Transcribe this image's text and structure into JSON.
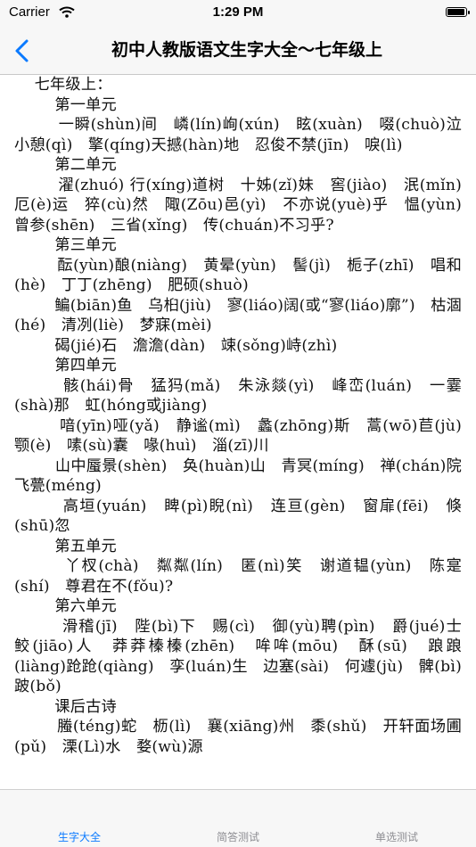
{
  "status_bar": {
    "carrier": "Carrier",
    "time": "1:29 PM"
  },
  "nav": {
    "title": "初中人教版语文生字大全～七年级上"
  },
  "content": {
    "text": "    七年级上：\n        第一单元\n        一瞬(shùn)间　嶙(lín)峋(xún)　眩(xuàn)　啜(chuò)泣　小憩(qì)　擎(qíng)天撼(hàn)地　忍俊不禁(jīn)　唳(lì)\n        第二单元\n        濯(zhuó) 行(xíng)道树　十姊(zǐ)妹　窖(jiào)　泯(mǐn)　厄(è)运　猝(cù)然　陬(Zōu)邑(yì)　不亦说(yuè)乎　愠(yùn)　曾参(shēn)　三省(xǐng)　传(chuán)不习乎?\n        第三单元\n        酝(yùn)酿(niàng)　黄晕(yùn)　髻(jì)　栀子(zhī)　唱和(hè)　丁丁(zhēng)　肥硕(shuò)\n        鳊(biān)鱼　乌桕(jiù)　寥(liáo)阔(或“寥(liáo)廓”)　枯涸(hé)　清冽(liè)　梦寐(mèi)\n        碣(jié)石　澹澹(dàn)　竦(sǒng)峙(zhì)\n        第四单元\n        骸(hái)骨　猛犸(mǎ)　朱泳燚(yì)　峰峦(luán)　一霎(shà)那　虹(hóng或jiàng)\n        喑(yīn)哑(yǎ)　静谧(mì)　蠡(zhōng)斯　蒿(wō)苣(jù)　颚(è)　嗉(sù)囊　喙(huì)　淄(zī)川\n        山中蜃景(shèn)　奂(huàn)山　青冥(míng)　禅(chán)院　飞甍(méng)\n        高垣(yuán)　睥(pì)睨(nì)　连亘(gèn)　窗扉(fēi)　倏(shū)忽\n        第五单元\n        丫杈(chà)　粼粼(lín)　匿(nì)笑　谢道韫(yùn)　陈寔(shí)　尊君在不(fǒu)?\n        第六单元\n        滑稽(jī)　陛(bì)下　赐(cì)　御(yù)聘(pìn)　爵(jué)士　鲛(jiāo)人　莽莽榛榛(zhēn)　哞哞(mōu)　酥(sū)　踉踉(liàng)跄跄(qiàng)　孪(luán)生　边塞(sài)　何遽(jù)　髀(bì)跛(bǒ)\n        课后古诗\n        螣(téng)蛇　枥(lì)　襄(xiāng)州　黍(shǔ)　开轩面场圃(pǔ)　溧(Lì)水　婺(wù)源"
  },
  "tabs": [
    {
      "label": "生字大全"
    },
    {
      "label": "简答测试"
    },
    {
      "label": "单选测试"
    }
  ],
  "colors": {
    "accent": "#0a7aff",
    "inactive": "#8e8e93"
  },
  "icons": {
    "back": "chevron-left-icon",
    "wifi": "wifi-icon",
    "battery": "battery-icon"
  }
}
